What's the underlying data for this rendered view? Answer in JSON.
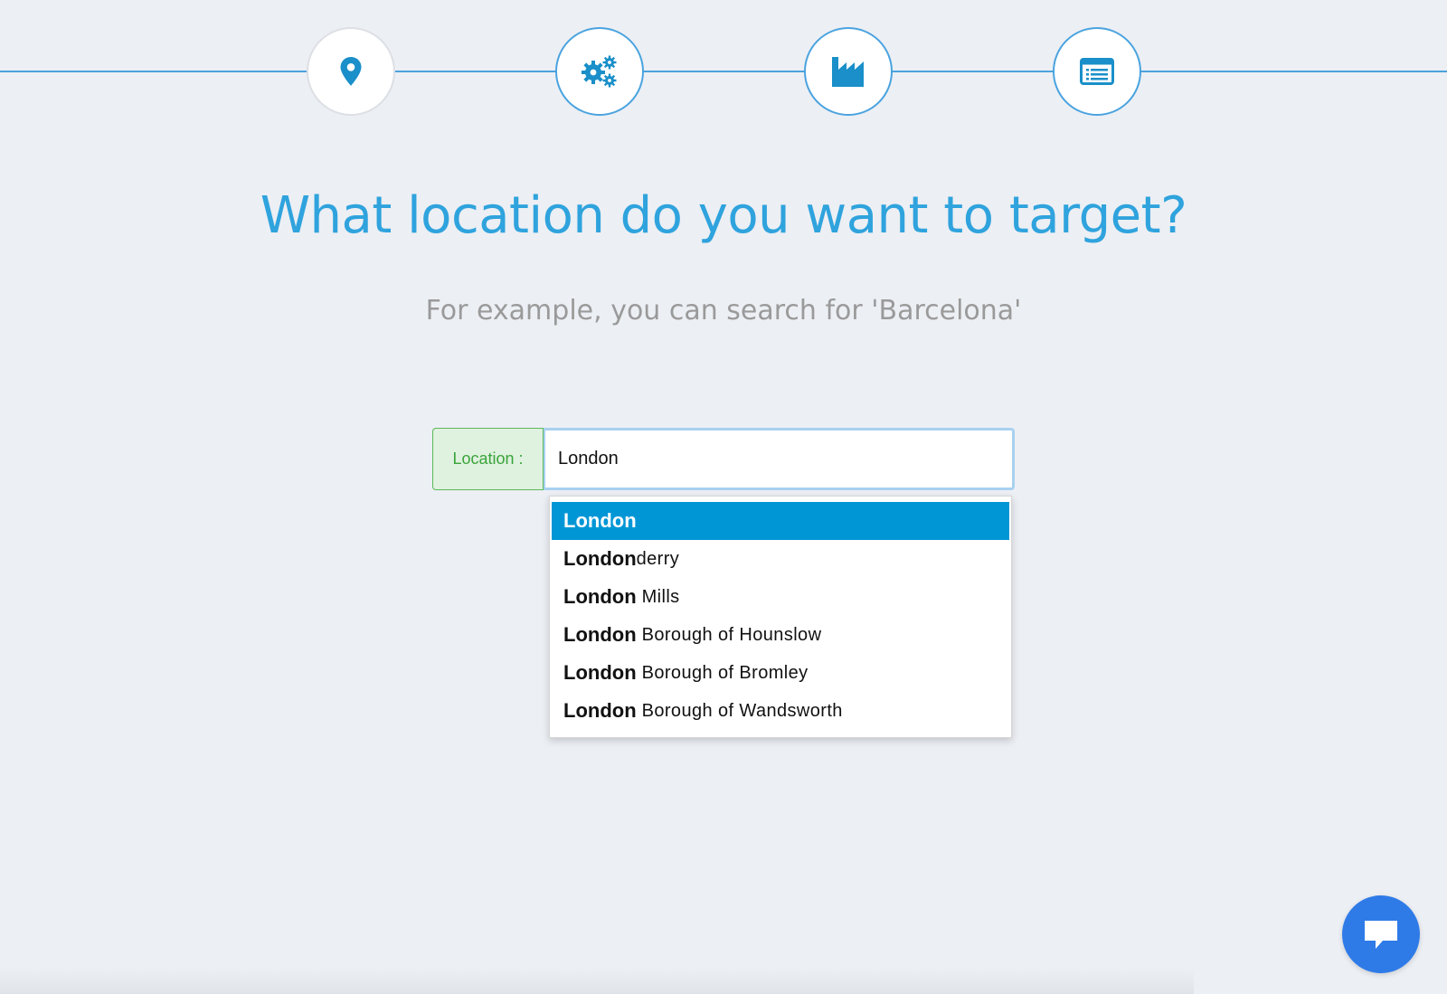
{
  "stepper": {
    "steps": [
      {
        "icon": "map-pin-icon",
        "state": "current"
      },
      {
        "icon": "gears-icon",
        "state": "upcoming"
      },
      {
        "icon": "factory-icon",
        "state": "upcoming"
      },
      {
        "icon": "list-window-icon",
        "state": "upcoming"
      }
    ],
    "accent_color": "#4aa3df"
  },
  "heading": {
    "title": "What location do you want to target?",
    "subtitle": "For example, you can search for 'Barcelona'"
  },
  "search": {
    "label": "Location :",
    "value": "London"
  },
  "suggestions": [
    {
      "match": "London",
      "rest": "",
      "active": true
    },
    {
      "match": "London",
      "rest": "derry",
      "active": false
    },
    {
      "match": "London",
      "rest": " Mills",
      "active": false
    },
    {
      "match": "London",
      "rest": " Borough of Hounslow",
      "active": false
    },
    {
      "match": "London",
      "rest": " Borough of Bromley",
      "active": false
    },
    {
      "match": "London",
      "rest": " Borough of Wandsworth",
      "active": false
    }
  ],
  "colors": {
    "title": "#2fa3dd",
    "active_suggestion": "#0096d6",
    "chat_button": "#2e7be8",
    "label_green": "#3aa43a"
  },
  "chat": {
    "icon": "chat-bubble-icon"
  }
}
